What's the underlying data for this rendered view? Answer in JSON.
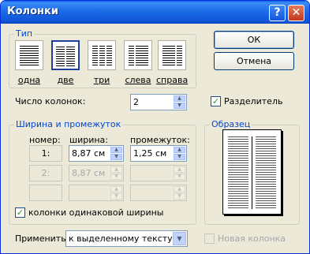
{
  "window": {
    "title": "Колонки",
    "help_symbol": "?",
    "close_symbol": "✕"
  },
  "presets": {
    "legend": "Тип",
    "items": [
      {
        "label": "одна",
        "selected": false
      },
      {
        "label": "две",
        "selected": true
      },
      {
        "label": "три",
        "selected": false
      },
      {
        "label": "слева",
        "selected": false
      },
      {
        "label": "справа",
        "selected": false
      }
    ]
  },
  "buttons": {
    "ok": "ОК",
    "cancel": "Отмена"
  },
  "columns_count": {
    "label": "Число колонок:",
    "value": "2"
  },
  "separator": {
    "label": "Разделитель",
    "checked": true
  },
  "width_spacing": {
    "legend": "Ширина и промежуток",
    "header_number": "номер:",
    "header_width": "ширина:",
    "header_spacing": "промежуток:",
    "rows": [
      {
        "number": "1:",
        "width": "8,87 см",
        "spacing": "1,25 см"
      },
      {
        "number": "2:",
        "width": "8,87 см",
        "spacing": ""
      },
      {
        "number": "",
        "width": "",
        "spacing": ""
      }
    ],
    "equal_width_label": "колонки одинаковой ширины",
    "equal_width_checked": true
  },
  "sample": {
    "legend": "Образец"
  },
  "apply": {
    "label": "Применить:",
    "value": "к выделенному тексту"
  },
  "new_column": {
    "label": "Новая колонка",
    "checked": false
  },
  "icons": {
    "spin_up": "▲",
    "spin_down": "▼",
    "dropdown": "▼",
    "check": "✓"
  }
}
